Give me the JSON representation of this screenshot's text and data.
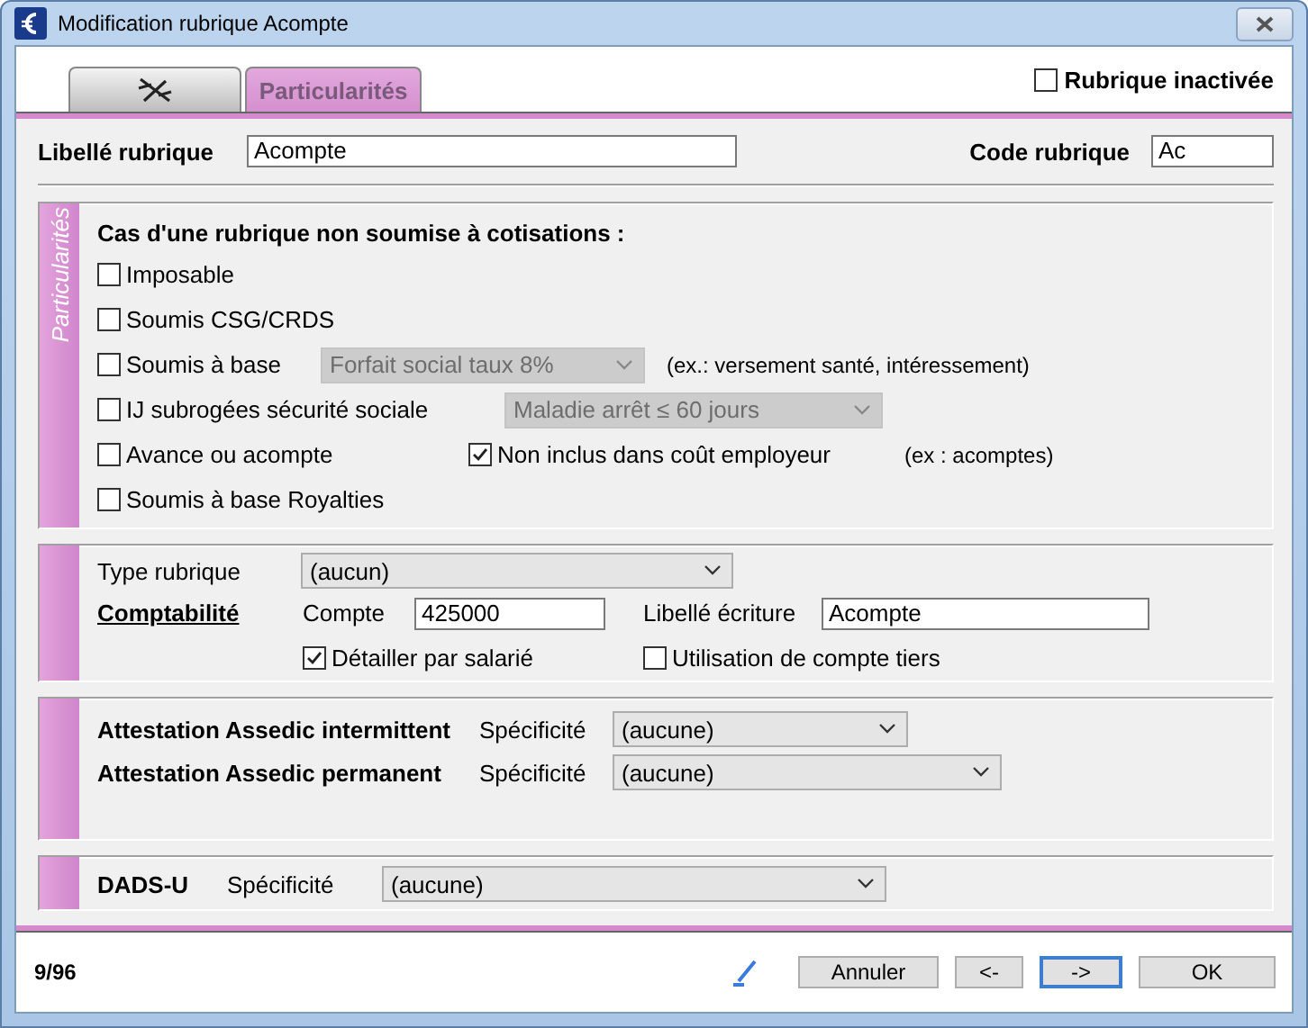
{
  "window": {
    "title": "Modification rubrique Acompte"
  },
  "tabs": [
    {
      "kind": "icon",
      "selected": false
    },
    {
      "kind": "text",
      "label": "Particularités",
      "selected": true
    }
  ],
  "inactive": {
    "label": "Rubrique inactivée",
    "checked": false
  },
  "libelle": {
    "label": "Libellé rubrique",
    "value": "Acompte"
  },
  "code": {
    "label": "Code rubrique",
    "value": "Ac"
  },
  "particularites": {
    "side_label": "Particularités",
    "heading": "Cas d'une rubrique non soumise à cotisations :",
    "options": [
      {
        "label": "Imposable",
        "checked": false
      },
      {
        "label": "Soumis CSG/CRDS",
        "checked": false
      },
      {
        "label": "Soumis à base",
        "checked": false,
        "select": {
          "value": "Forfait social taux 8%",
          "disabled": true
        },
        "note": "(ex.: versement santé, intéressement)"
      },
      {
        "label": "IJ subrogées sécurité sociale",
        "checked": false,
        "select": {
          "value": "Maladie arrêt ≤ 60 jours",
          "disabled": true
        }
      },
      {
        "label": "Avance ou acompte",
        "checked": false,
        "extra": {
          "label": "Non inclus dans coût employeur",
          "checked": true
        },
        "note": "(ex : acomptes)"
      },
      {
        "label": "Soumis à base Royalties",
        "checked": false
      }
    ]
  },
  "type_rubrique": {
    "label": "Type rubrique",
    "value": "(aucun)"
  },
  "comptabilite": {
    "label": "Comptabilité",
    "compte_label": "Compte",
    "compte": "425000",
    "libelle_label": "Libellé écriture",
    "libelle": "Acompte",
    "detail": {
      "label": "Détailler par salarié",
      "checked": true
    },
    "tiers": {
      "label": "Utilisation de compte tiers",
      "checked": false
    }
  },
  "assedic": [
    {
      "label": "Attestation Assedic intermittent",
      "spec_label": "Spécificité",
      "value": "(aucune)"
    },
    {
      "label": "Attestation Assedic permanent",
      "spec_label": "Spécificité",
      "value": "(aucune)"
    }
  ],
  "dads": {
    "label": "DADS-U",
    "spec_label": "Spécificité",
    "value": "(aucune)"
  },
  "counter": "9/96",
  "buttons": [
    {
      "label": "Annuler",
      "focused": false
    },
    {
      "label": "<-",
      "focused": false
    },
    {
      "label": "->",
      "focused": true
    },
    {
      "label": "OK",
      "focused": false
    }
  ]
}
